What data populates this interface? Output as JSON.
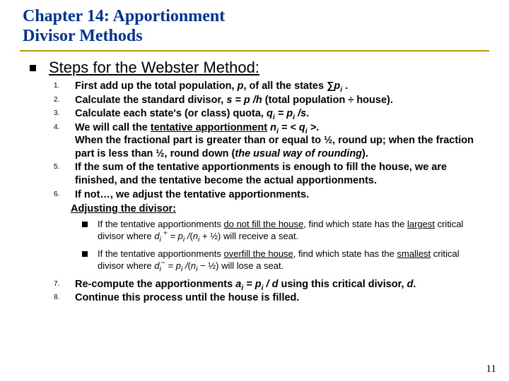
{
  "title": {
    "line1": "Chapter 14:  Apportionment",
    "line2": "Divisor Methods"
  },
  "subhead": "Steps for the Webster Method:",
  "steps": [
    {
      "num": "1.",
      "html": "First add up the total population, <span class='ital'>p</span>, of all the states <span class='ital'>∑p<span class='sub'>i</span></span> ."
    },
    {
      "num": "2.",
      "html": "Calculate the standard divisor, <span class='ital'>s = p /h</span>  (total population ÷ house)."
    },
    {
      "num": "3.",
      "html": "Calculate each state's (or class) quota, <span class='ital'>q<span class='sub'>i</span> = p<span class='sub'>i</span> /s</span>."
    },
    {
      "num": "4.",
      "html": "We will call the <span class='ul'>tentative apportionment</span>  <span class='ital'>n<span class='sub'>i</span> = &lt; q<span class='sub'>i</span> &gt;</span>.<br>When the fractional part is greater than or equal to ½, round up; when the fraction part is less than ½, round down (<span class='ital'>the usual way of rounding</span>)."
    },
    {
      "num": "5.",
      "html": "If the sum of the tentative apportionments is enough to fill the house, we are finished, and the tentative become the actual apportionments."
    },
    {
      "num": "6.",
      "html": "If not…, we adjust the tentative apportionments."
    }
  ],
  "adjusting": "Adjusting the divisor:",
  "subs": [
    {
      "html": "If the tentative apportionments <span class='ul'>do not fill the house</span>, find which state has the <span class='ul'>largest</span> critical divisor where  <span class='ital'>d<span class='sub'>i</span><span class='sup'> +</span> = p<span class='sub'>i</span> /</span>(<span class='ital'>n<span class='sub'>i</span></span> + ½)  will receive a seat."
    },
    {
      "html": "If the tentative apportionments <span class='ul'>overfill the house</span>, find which state has the <span class='ul'>smallest</span> critical divisor where  <span class='ital'>d<span class='sub'>i</span><span class='sup'>−</span> = p<span class='sub'>i</span> /</span>(<span class='ital'>n<span class='sub'>i</span></span> − ½) will lose a seat."
    }
  ],
  "steps2": [
    {
      "num": "7.",
      "html": "Re-compute the apportionments <span class='ital'>a<span class='sub'>i</span> = p<span class='sub'>i</span> / d</span> using this critical divisor, <span class='ital'>d</span>."
    },
    {
      "num": "8.",
      "html": "Continue this process until the house is filled."
    }
  ],
  "pagenum": "11"
}
